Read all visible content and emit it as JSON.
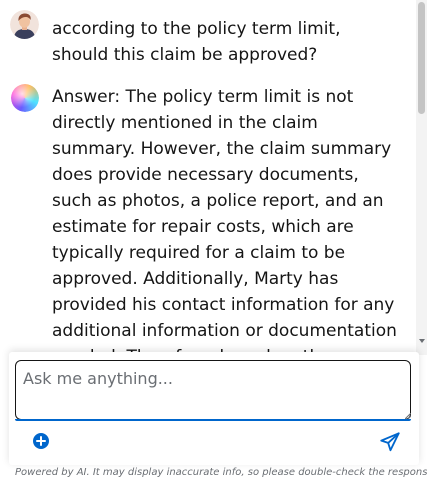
{
  "conversation": {
    "user_message": "according to the policy term limit, should this claim be approved?",
    "bot_message": "Answer: The policy term limit is not directly mentioned in the claim summary. However, the claim summary does provide necessary documents, such as photos, a police report, and an estimate for repair costs, which are typically required for a claim to be approved. Additionally, Marty has provided his contact information for any additional information or documentation needed. Therefore, based on the information provided, it is reasonable to assume that the claim should be approved."
  },
  "composer": {
    "placeholder": "Ask me anything..."
  },
  "footer": {
    "disclaimer": "Powered by AI. It may display inaccurate info, so please double-check the responses."
  },
  "icons": {
    "user_avatar": "user-avatar-icon",
    "bot_avatar": "ai-orb-icon",
    "attach": "plus-circle-icon",
    "send": "paper-plane-icon"
  },
  "colors": {
    "accent": "#0066cc",
    "text": "#151515",
    "muted": "#6a6e73"
  }
}
